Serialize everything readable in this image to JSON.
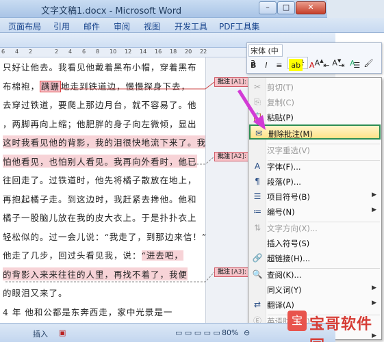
{
  "window": {
    "title": "文字文稿1.docx - Microsoft Word",
    "min": "–",
    "max": "□",
    "close": "✕"
  },
  "tabs": [
    "页面布局",
    "引用",
    "邮件",
    "审阅",
    "视图",
    "开发工具",
    "PDF工具集"
  ],
  "ruler": [
    "6",
    "4",
    "2",
    "2",
    "4",
    "6",
    "8",
    "10",
    "12",
    "14",
    "16",
    "18",
    "20",
    "22"
  ],
  "document": {
    "lines": [
      {
        "segments": [
          {
            "t": "只好让他去。我看见他戴着黑布小帽，穿着黑布"
          }
        ]
      },
      {
        "segments": [
          {
            "t": "布棉袍，"
          },
          {
            "t": "蹒跚",
            "style": "box"
          },
          {
            "t": "地走到铁道边，慢慢探身下去，"
          }
        ]
      },
      {
        "segments": [
          {
            "t": "去穿过铁道，要爬上那边月台，就不容易了。他"
          }
        ]
      },
      {
        "segments": [
          {
            "t": "，两脚再向上缩；他肥胖的身子向左微倾，显出"
          }
        ]
      },
      {
        "segments": [
          {
            "t": "这时我看见他的背影，我的泪很快地流下来了。我"
          }
        ],
        "hl": true
      },
      {
        "segments": [
          {
            "t": "怕他看见，也怕别人看见。我再向外看时，他已"
          }
        ],
        "hl": true
      },
      {
        "segments": [
          {
            "t": "往回走了。过铁道时，他先将橘子散放在地上，"
          }
        ]
      },
      {
        "segments": [
          {
            "t": "再抱起橘子走。到这边时，我赶紧去搀他。他和"
          }
        ]
      },
      {
        "segments": [
          {
            "t": "橘子一股脑儿放在我的皮大衣上。于是扑扑衣上"
          }
        ]
      },
      {
        "segments": [
          {
            "t": "轻松似的。过一会儿说：“我走了，到那边来信！”"
          }
        ]
      },
      {
        "segments": [
          {
            "t": "他走了几步，回过头看见我，说："
          },
          {
            "t": "“进去吧，",
            "style": "hl"
          }
        ]
      },
      {
        "segments": [
          {
            "t": "的背影入来来往往的人里，再找不着了，我便"
          }
        ],
        "hl": true
      },
      {
        "segments": [
          {
            "t": "的眼泪又来了。"
          }
        ]
      },
      {
        "segments": [
          {
            "t": "4  年 他和公都是东奔西走，家中光景是一"
          }
        ]
      }
    ]
  },
  "comments": [
    {
      "label": "批注",
      "ref": "[A1]:"
    },
    {
      "label": "批注",
      "ref": "[A2]:"
    },
    {
      "label": "批注",
      "ref": "[A3]:"
    }
  ],
  "mini_toolbar": {
    "font": "宋体 (中3",
    "size": "五号",
    "bold": "B",
    "italic": "I"
  },
  "context_menu": [
    {
      "label": "剪切(T)",
      "icon": "scissors-icon",
      "disabled": true
    },
    {
      "label": "复制(C)",
      "icon": "copy-icon",
      "disabled": true
    },
    {
      "label": "粘贴(P)",
      "icon": "paste-icon",
      "disabled": false
    },
    {
      "label": "删除批注(M)",
      "icon": "delete-comment-icon",
      "disabled": false,
      "highlight": true
    },
    {
      "label": "汉字重选(V)",
      "icon": "",
      "disabled": true
    },
    {
      "label": "字体(F)...",
      "icon": "font-icon",
      "disabled": false
    },
    {
      "label": "段落(P)...",
      "icon": "paragraph-icon",
      "disabled": false
    },
    {
      "label": "项目符号(B)",
      "icon": "bullets-icon",
      "disabled": false,
      "submenu": true
    },
    {
      "label": "编号(N)",
      "icon": "numbering-icon",
      "disabled": false,
      "submenu": true
    },
    {
      "label": "文字方向(X)...",
      "icon": "text-direction-icon",
      "disabled": true
    },
    {
      "label": "插入符号(S)",
      "icon": "",
      "disabled": false
    },
    {
      "label": "超链接(H)...",
      "icon": "hyperlink-icon",
      "disabled": false
    },
    {
      "label": "查阅(K)...",
      "icon": "research-icon",
      "disabled": false
    },
    {
      "label": "同义词(Y)",
      "icon": "",
      "disabled": false,
      "submenu": true
    },
    {
      "label": "翻译(A)",
      "icon": "translate-icon",
      "disabled": false,
      "submenu": true
    },
    {
      "label": "英语助手(A)",
      "icon": "english-assistant-icon",
      "disabled": true
    },
    {
      "label": "样式(T)",
      "icon": "",
      "disabled": false,
      "submenu": true
    }
  ],
  "status": {
    "mode": "插入",
    "zoom": "80%"
  },
  "watermark": {
    "text": "宝哥软件园"
  }
}
